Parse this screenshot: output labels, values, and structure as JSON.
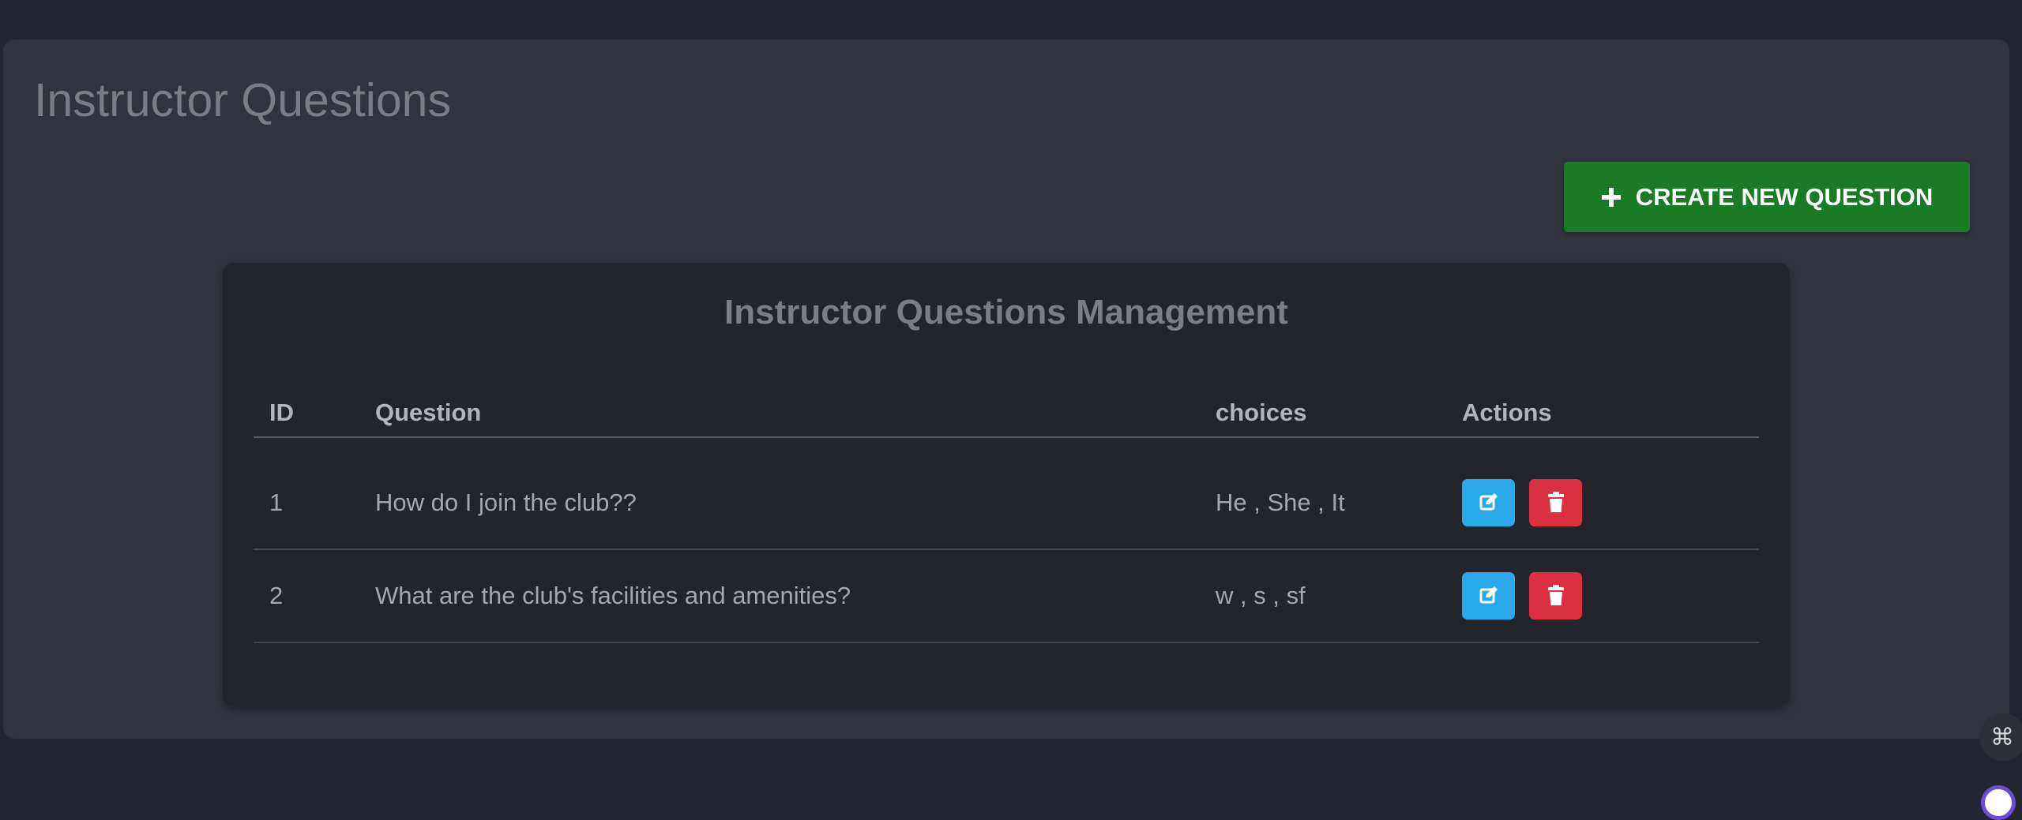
{
  "page": {
    "title": "Instructor Questions"
  },
  "toolbar": {
    "create_label": "CREATE NEW QUESTION",
    "create_icon": "plus-icon",
    "create_color": "#1a7a25"
  },
  "table_card": {
    "title": "Instructor Questions Management",
    "headers": {
      "id": "ID",
      "question": "Question",
      "choices": "choices",
      "actions": "Actions"
    },
    "rows": [
      {
        "id": "1",
        "question": "How do I join the club??",
        "choices": "He , She , It"
      },
      {
        "id": "2",
        "question": "What are the club's facilities and amenities?",
        "choices": "w , s , sf"
      }
    ],
    "actions": {
      "edit_icon": "edit-icon",
      "edit_color": "#29a8ea",
      "delete_icon": "trash-icon",
      "delete_color": "#dc3040"
    }
  },
  "side_widget": {
    "icon": "command-icon",
    "glyph": "⌘"
  }
}
